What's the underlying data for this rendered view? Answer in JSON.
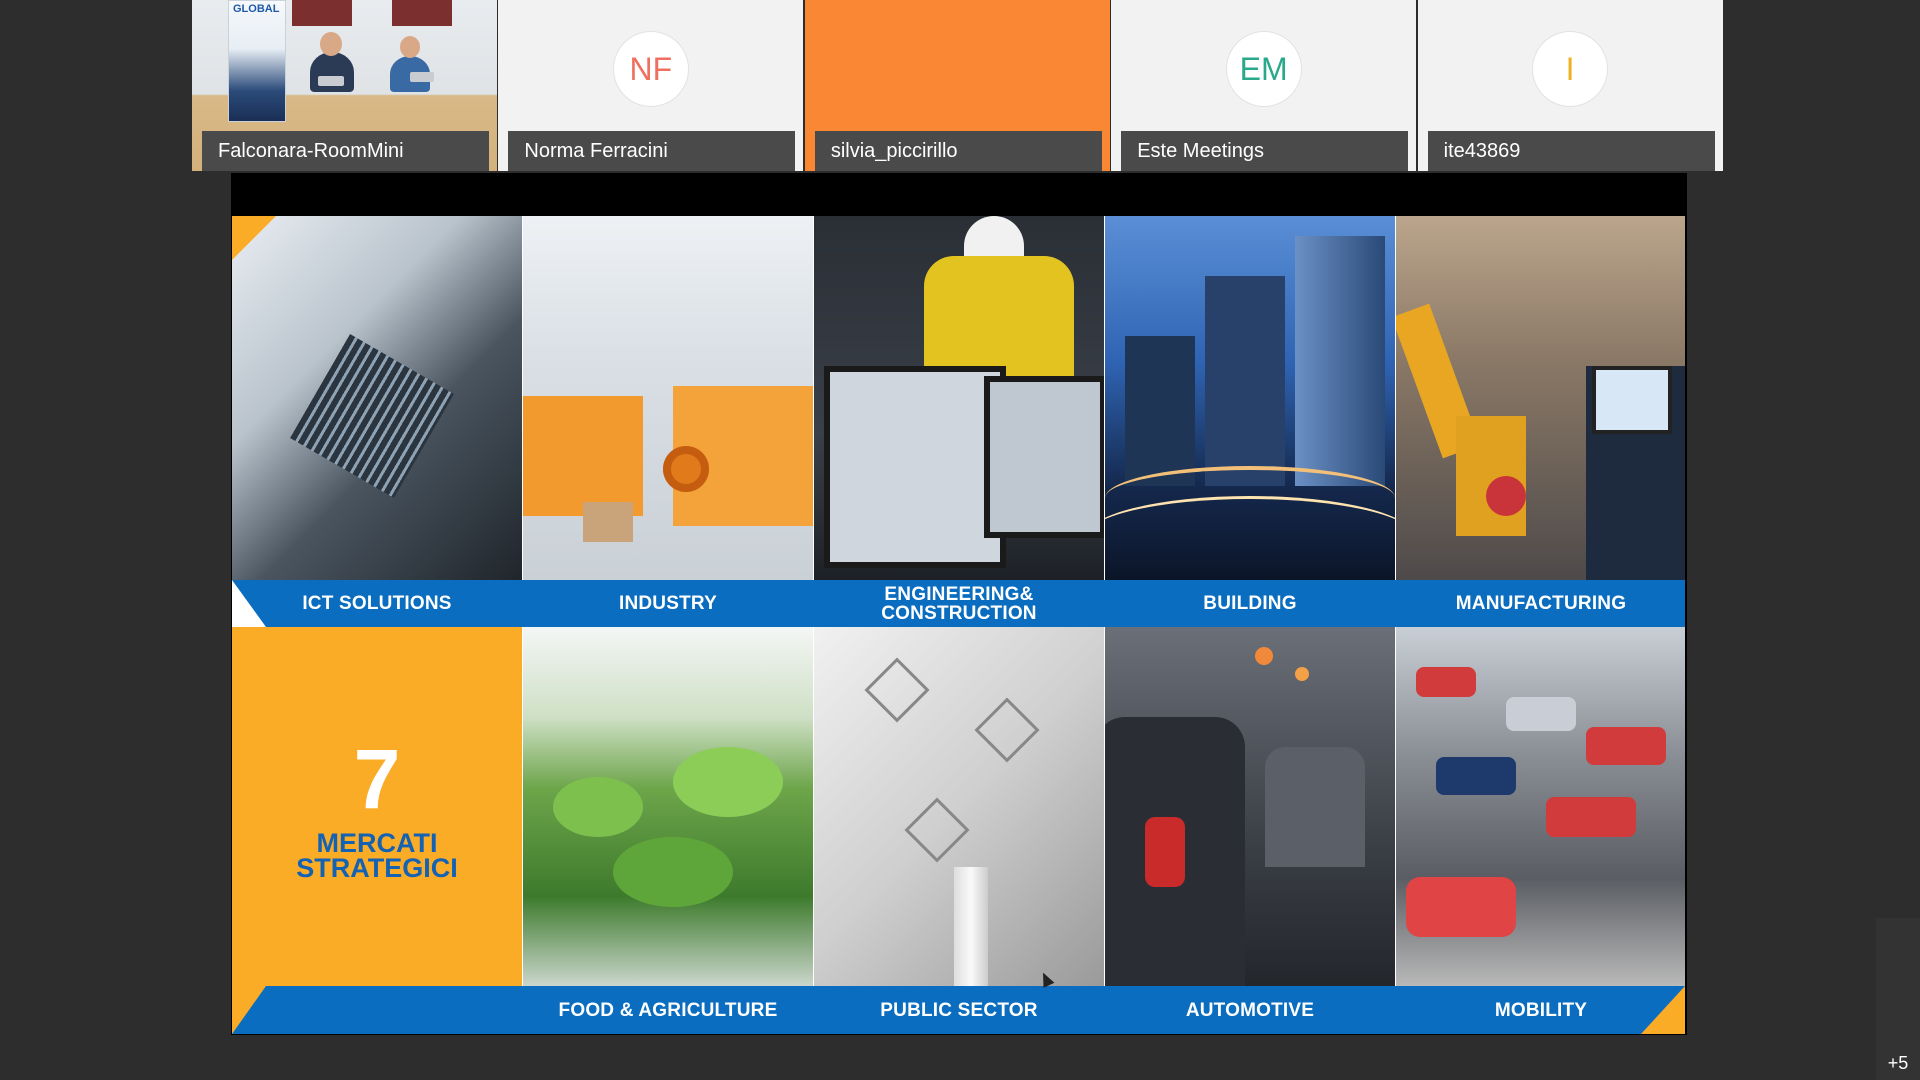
{
  "participants": [
    {
      "name": "Falconara-RoomMini",
      "type": "video",
      "banner_text": "GLOBAL"
    },
    {
      "name": "Norma Ferracini",
      "initials": "NF",
      "initials_color": "#f07060",
      "type": "avatar"
    },
    {
      "name": "silvia_piccirillo",
      "type": "orange"
    },
    {
      "name": "Este Meetings",
      "initials": "EM",
      "initials_color": "#2aa88a",
      "type": "avatar"
    },
    {
      "name": "ite43869",
      "initials": "I",
      "initials_color": "#f0b020",
      "type": "avatar"
    }
  ],
  "slide": {
    "top_row": [
      "ICT SOLUTIONS",
      "INDUSTRY",
      "ENGINEERING&",
      "CONSTRUCTION",
      "BUILDING",
      "MANUFACTURING"
    ],
    "bottom_row": [
      "FOOD & AGRICULTURE",
      "PUBLIC SECTOR",
      "AUTOMOTIVE",
      "MOBILITY"
    ],
    "highlight_number": "7",
    "highlight_line1": "MERCATI",
    "highlight_line2": "STRATEGICI",
    "colors": {
      "band": "#0a6dbf",
      "accent": "#fbac26"
    }
  },
  "overflow_count": "+5"
}
